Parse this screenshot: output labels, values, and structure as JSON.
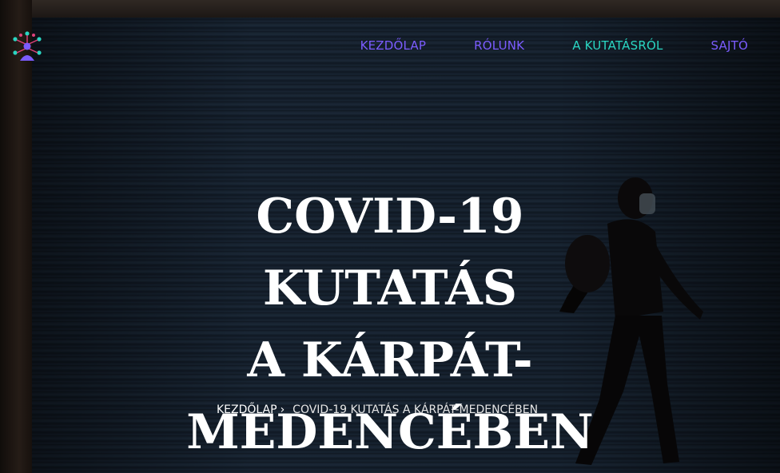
{
  "nav": {
    "items": [
      {
        "label": "KEZDŐLAP",
        "color": "#7b5cff"
      },
      {
        "label": "RÓLUNK",
        "color": "#7b5cff"
      },
      {
        "label": "A KUTATÁSRÓL",
        "color": "#2ad6c2"
      },
      {
        "label": "SAJTÓ",
        "color": "#7b5cff"
      }
    ]
  },
  "logo": {
    "icon": "network-people-icon",
    "colors": [
      "#2ad6c2",
      "#e0427a",
      "#7b5cff"
    ]
  },
  "hero": {
    "title_line1": "COVID-19 KUTATÁS",
    "title_line2": "A KÁRPÁT-",
    "title_line3": "MEDENCÉBEN"
  },
  "breadcrumb": {
    "home": "KEZDŐLAP",
    "separator": "›",
    "current": "COVID-19 KUTATÁS A KÁRPÁT-MEDENCÉBEN"
  }
}
